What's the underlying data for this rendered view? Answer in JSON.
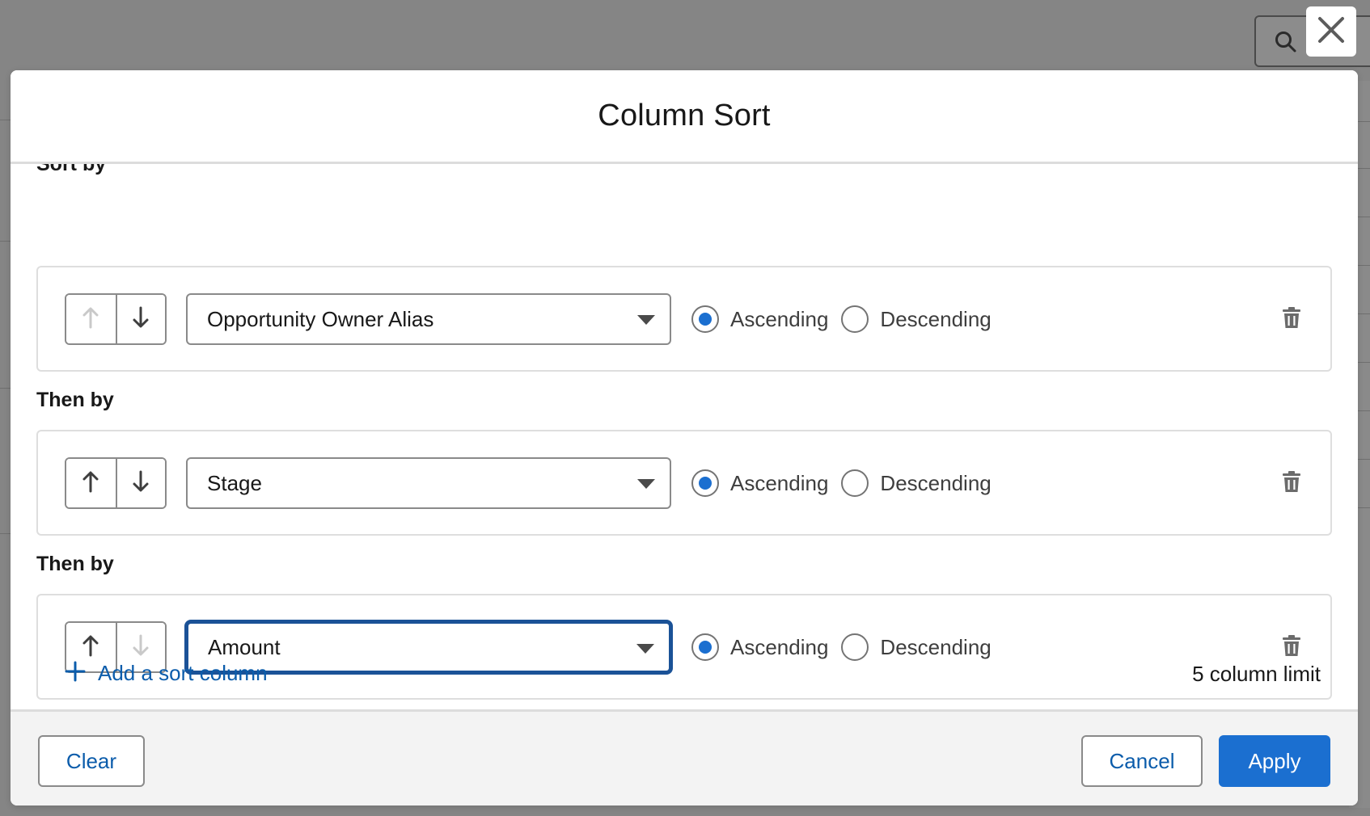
{
  "modal": {
    "title": "Column Sort",
    "first_label": "Sort by",
    "then_label": "Then by",
    "close_icon": "close-icon"
  },
  "sort_rows": [
    {
      "field": "Opportunity Owner Alias",
      "order": "Ascending",
      "up_enabled": false,
      "down_enabled": true
    },
    {
      "field": "Stage",
      "order": "Ascending",
      "up_enabled": true,
      "down_enabled": true
    },
    {
      "field": "Amount",
      "order": "Ascending",
      "up_enabled": true,
      "down_enabled": false
    }
  ],
  "order_options": {
    "ascending": "Ascending",
    "descending": "Descending"
  },
  "add_sort_label": "Add a sort column",
  "column_limit": "5 column limit",
  "footer": {
    "clear_label": "Clear",
    "cancel_label": "Cancel",
    "apply_label": "Apply"
  },
  "colors": {
    "brand": "#1b6fd0",
    "link": "#0b5cab",
    "focus": "#1b5297"
  }
}
